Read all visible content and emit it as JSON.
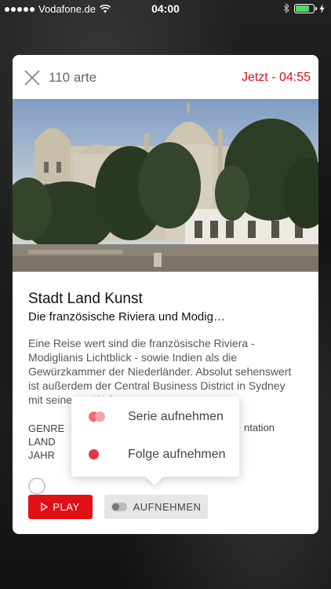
{
  "status_bar": {
    "carrier": "Vodafone.de",
    "time": "04:00"
  },
  "header": {
    "channel": "110 arte",
    "now_label": "Jetzt - 04:55"
  },
  "program": {
    "title": "Stadt Land Kunst",
    "subtitle": "Die französische Riviera und Modig…",
    "description": "Eine Reise wert sind die französische Riviera - Modiglianis Lichtblick - sowie Indien als die Gewürzkammer der Niederländer. Absolut sehenswert ist außerdem der Central Business District in Sydney mit seinen ... Welt ... atzern."
  },
  "meta": {
    "keys": [
      "GENRE",
      "LAND",
      "JAHR"
    ],
    "genre_value_partial": "ntation"
  },
  "popup": {
    "series_label": "Serie aufnehmen",
    "episode_label": "Folge aufnehmen"
  },
  "buttons": {
    "play_label": "PLAY",
    "record_label": "AUFNEHMEN"
  },
  "colors": {
    "accent_red": "#e01016",
    "now_red": "#d9131b"
  }
}
